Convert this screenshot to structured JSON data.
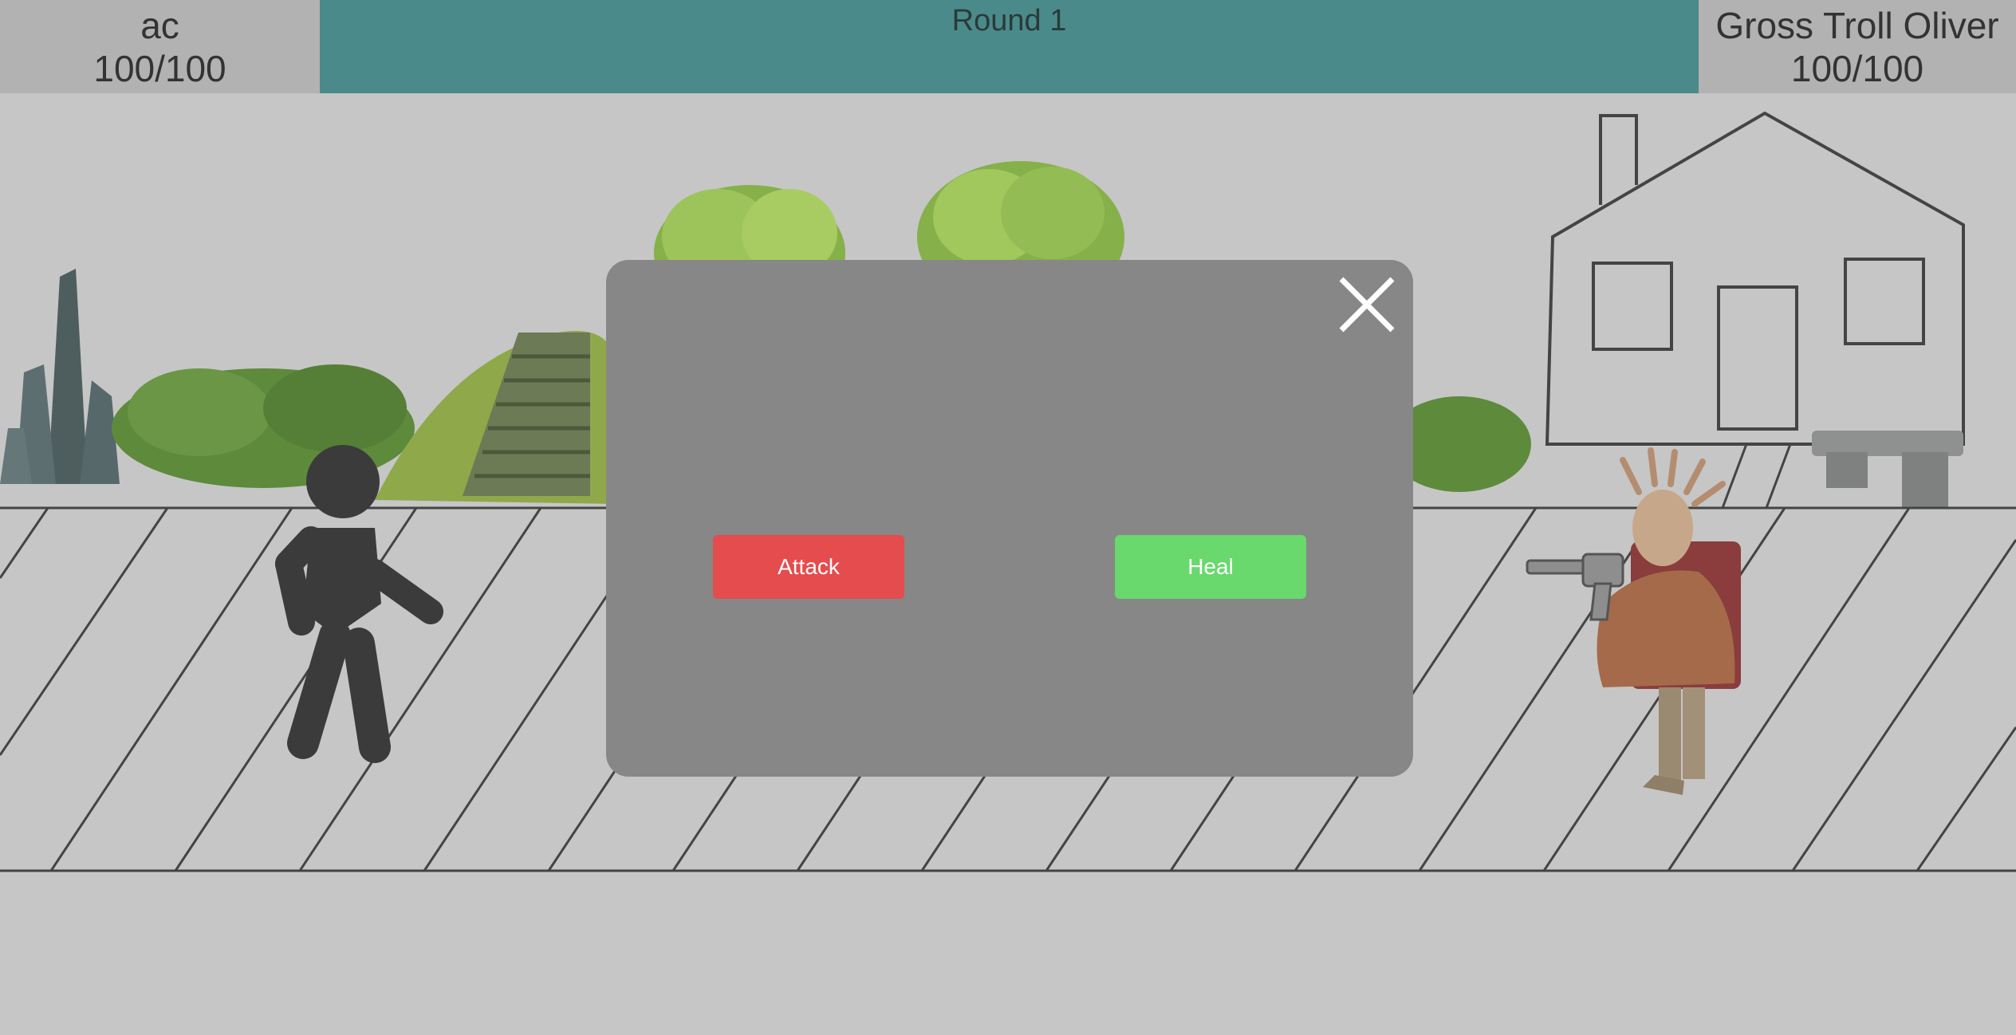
{
  "player": {
    "name": "ac",
    "hp_text": "100/100"
  },
  "enemy": {
    "name": "Gross Troll Oliver",
    "hp_text": "100/100"
  },
  "round": {
    "label": "Round 1"
  },
  "modal": {
    "attack_label": "Attack",
    "heal_label": "Heal",
    "close_icon": "close-icon"
  },
  "scene": {
    "player_sprite": "stick-figure",
    "enemy_sprite": "troll-with-revolver",
    "props": [
      "crystal-rock",
      "bush",
      "mossy-stairs",
      "house",
      "stone-bench"
    ]
  },
  "colors": {
    "round_bar": "#4b8a8a",
    "hud_box": "#b2b2b2",
    "modal_bg": "#878787",
    "attack": "#e44c4e",
    "heal": "#69d86d",
    "background": "#c6c6c6"
  }
}
